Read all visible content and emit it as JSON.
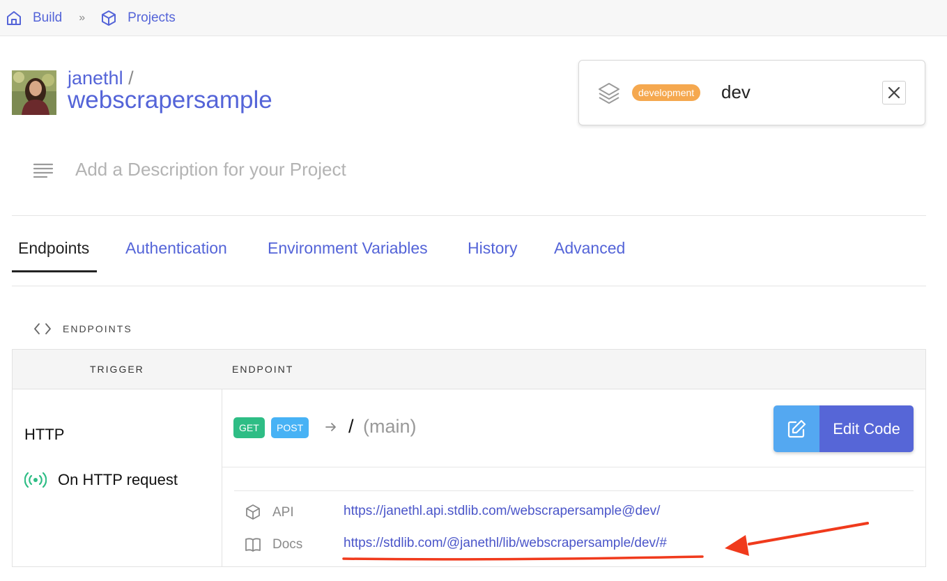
{
  "breadcrumb": {
    "items": [
      {
        "label": "Build",
        "icon": "home-icon"
      },
      {
        "label": "Projects",
        "icon": "cube-icon"
      }
    ],
    "separator": "»"
  },
  "project": {
    "owner": "janethl",
    "owner_separator": "/",
    "name": "webscrapersample"
  },
  "environment": {
    "badge": "development",
    "name": "dev",
    "badge_color": "#f5a84f"
  },
  "description": {
    "placeholder": "Add a Description for your Project"
  },
  "tabs": [
    {
      "label": "Endpoints",
      "active": true
    },
    {
      "label": "Authentication",
      "active": false
    },
    {
      "label": "Environment Variables",
      "active": false
    },
    {
      "label": "History",
      "active": false
    },
    {
      "label": "Advanced",
      "active": false
    }
  ],
  "endpoints_section": {
    "title": "ENDPOINTS",
    "columns": [
      "TRIGGER",
      "ENDPOINT"
    ],
    "rows": [
      {
        "trigger_type": "HTTP",
        "trigger_event": "On HTTP request",
        "methods": [
          "GET",
          "POST"
        ],
        "path": "/",
        "path_name": "(main)",
        "edit_label": "Edit Code",
        "links": [
          {
            "label": "API",
            "url": "https://janethl.api.stdlib.com/webscrapersample@dev/",
            "icon": "cube-icon"
          },
          {
            "label": "Docs",
            "url": "https://stdlib.com/@janethl/lib/webscrapersample/dev/#",
            "icon": "book-icon"
          }
        ]
      }
    ]
  },
  "colors": {
    "link": "#5464d8",
    "get": "#2ebd85",
    "post": "#47b2f5",
    "edit_button": "#5666d7",
    "annotation": "#f03a1c"
  }
}
